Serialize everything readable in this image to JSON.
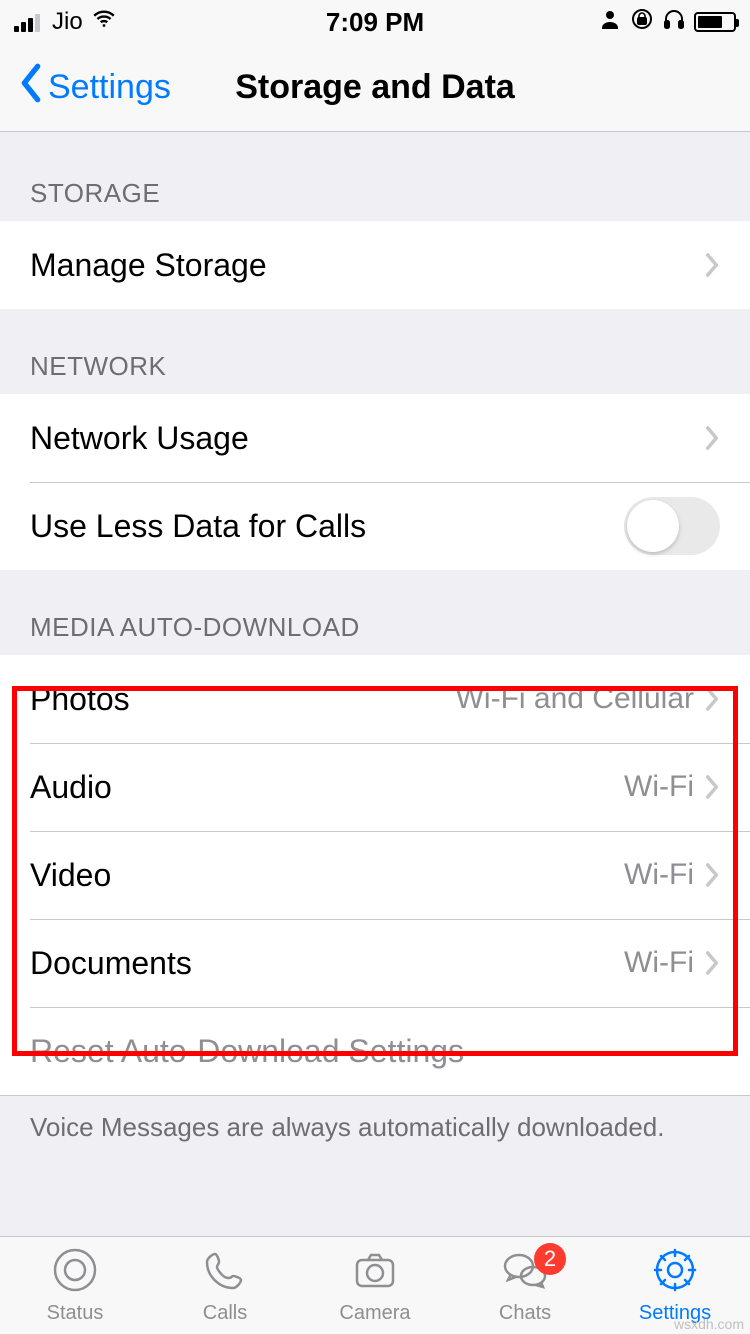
{
  "status_bar": {
    "carrier": "Jio",
    "time": "7:09 PM"
  },
  "nav": {
    "back_label": "Settings",
    "title": "Storage and Data"
  },
  "sections": {
    "storage": {
      "header": "STORAGE",
      "manage_storage": "Manage Storage"
    },
    "network": {
      "header": "NETWORK",
      "network_usage": "Network Usage",
      "less_data": "Use Less Data for Calls",
      "less_data_on": false
    },
    "media": {
      "header": "MEDIA AUTO-DOWNLOAD",
      "items": [
        {
          "label": "Photos",
          "value": "Wi-Fi and Cellular"
        },
        {
          "label": "Audio",
          "value": "Wi-Fi"
        },
        {
          "label": "Video",
          "value": "Wi-Fi"
        },
        {
          "label": "Documents",
          "value": "Wi-Fi"
        }
      ],
      "reset": "Reset Auto-Download Settings",
      "footer": "Voice Messages are always automatically downloaded."
    }
  },
  "tabs": {
    "status": "Status",
    "calls": "Calls",
    "camera": "Camera",
    "chats": "Chats",
    "chats_badge": "2",
    "settings": "Settings"
  },
  "watermark": "wsxdh.com"
}
